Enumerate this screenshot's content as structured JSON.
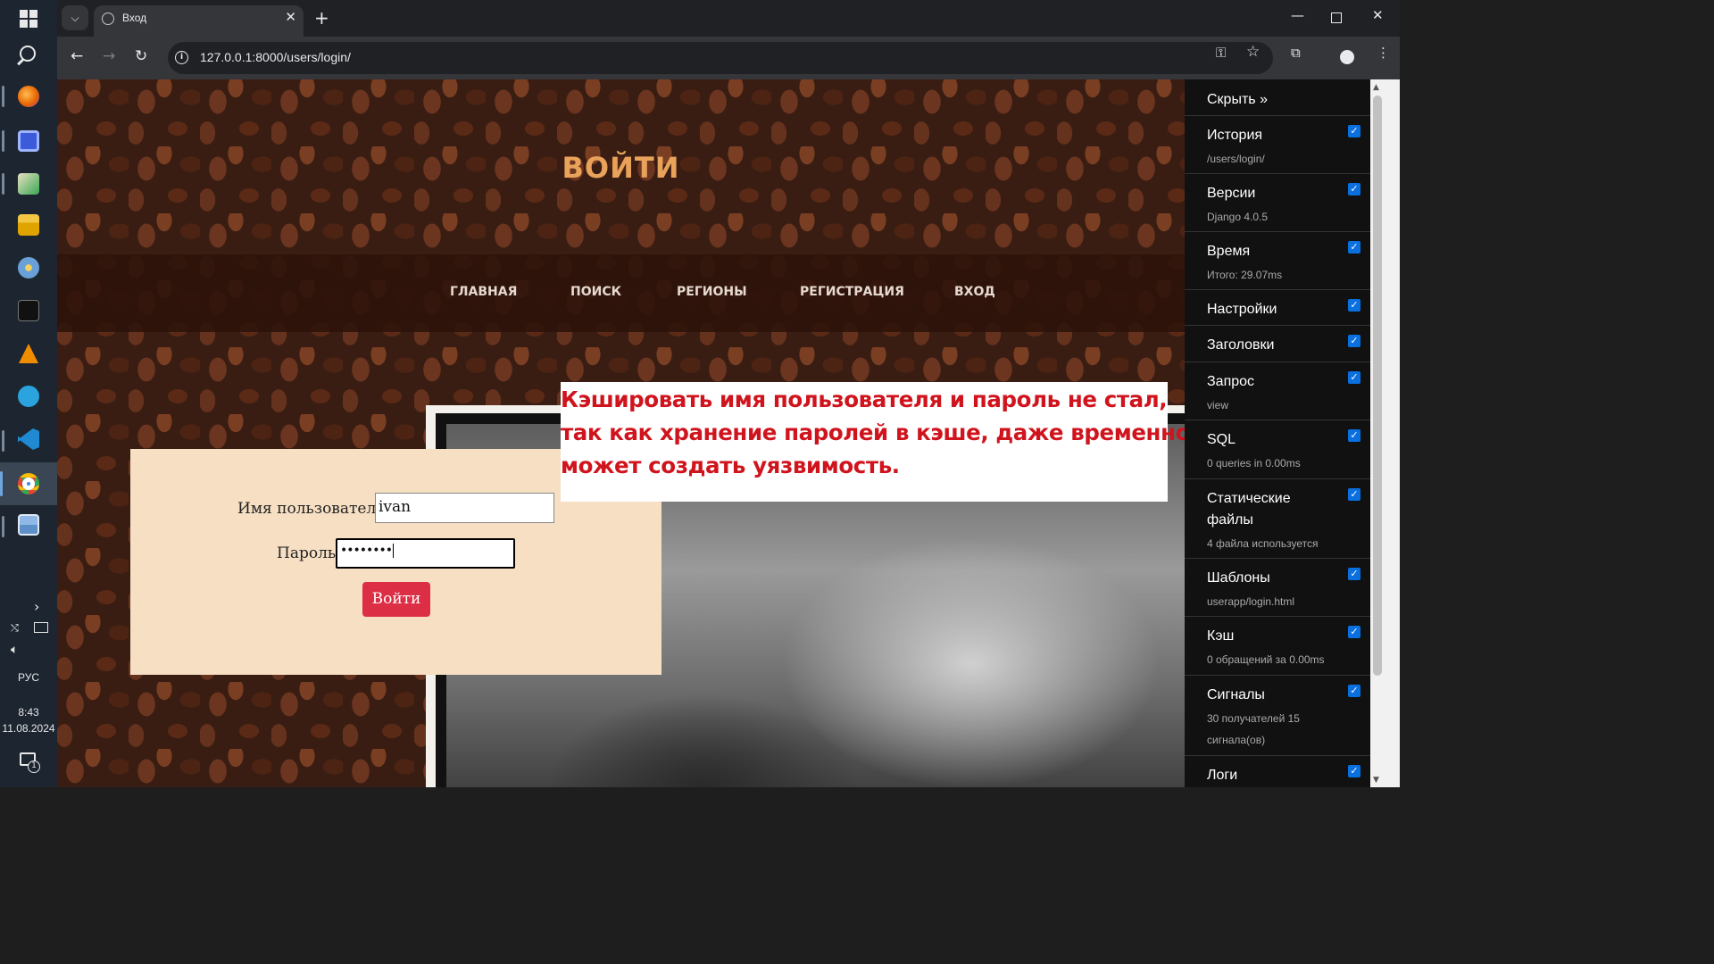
{
  "taskbar": {
    "lang": "РУС",
    "time": "8:43",
    "date": "11.08.2024",
    "notification_count": "1",
    "apps": [
      {
        "name": "firefox-icon",
        "color": "#e66000"
      },
      {
        "name": "floppy-save-icon",
        "color": "#3b5bdb"
      },
      {
        "name": "image-editor-icon",
        "color": "#3aa655"
      },
      {
        "name": "file-explorer-icon",
        "color": "#f2c744"
      },
      {
        "name": "paint-icon",
        "color": "#6aa0d8"
      },
      {
        "name": "terminal-icon",
        "color": "#111111"
      },
      {
        "name": "vlc-icon",
        "color": "#f08c00"
      },
      {
        "name": "telegram-icon",
        "color": "#2aa3df"
      },
      {
        "name": "vscode-icon",
        "color": "#1f8ad2"
      },
      {
        "name": "chrome-icon",
        "color": "#4285f4"
      },
      {
        "name": "photos-icon",
        "color": "#5d8fc9"
      }
    ]
  },
  "browser": {
    "tab_title": "Вход",
    "url": "127.0.0.1:8000/users/login/"
  },
  "page": {
    "title": "ВОЙТИ",
    "nav": [
      "ГЛАВНАЯ",
      "ПОИСК",
      "РЕГИОНЫ",
      "РЕГИСТРАЦИЯ",
      "ВХОД"
    ],
    "form": {
      "username_label": "Имя пользователя:",
      "username_value": "ivan",
      "password_label": "Пароль:",
      "password_value": "••••••••",
      "submit_label": "Войти"
    },
    "annotation": [
      "Кэшировать имя пользователя и пароль не стал,",
      "так как хранение паролей в кэше, даже временно,",
      "может создать уязвимость."
    ]
  },
  "debug_toolbar": {
    "hide_label": "Скрыть »",
    "panels": [
      {
        "title": "История",
        "subtitle": "/users/login/"
      },
      {
        "title": "Версии",
        "subtitle": "Django 4.0.5"
      },
      {
        "title": "Время",
        "subtitle": "Итого: 29.07ms"
      },
      {
        "title": "Настройки",
        "subtitle": ""
      },
      {
        "title": "Заголовки",
        "subtitle": ""
      },
      {
        "title": "Запрос",
        "subtitle": "view"
      },
      {
        "title": "SQL",
        "subtitle": "0 queries in 0.00ms"
      },
      {
        "title": "Статические файлы",
        "subtitle": "4 файла используется"
      },
      {
        "title": "Шаблоны",
        "subtitle": "userapp/login.html"
      },
      {
        "title": "Кэш",
        "subtitle": "0 обращений за 0.00ms"
      },
      {
        "title": "Сигналы",
        "subtitle": "30 получателей 15 сигнала(ов)"
      },
      {
        "title": "Логи",
        "subtitle": ""
      }
    ]
  }
}
